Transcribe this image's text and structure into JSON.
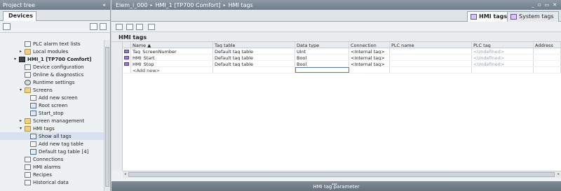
{
  "project_tree": {
    "title": "Project tree",
    "devices_tab": "Devices",
    "items": [
      {
        "label": "PLC alarm text lists",
        "expander": "",
        "icon": "list-icon"
      },
      {
        "label": "Local modules",
        "expander": "▸",
        "icon": "module-folder-icon"
      },
      {
        "label": "HMI_1 [TP700 Comfort]",
        "expander": "▾",
        "icon": "hmi-device-icon"
      },
      {
        "label": "Device configuration",
        "expander": "",
        "icon": "device-config-icon"
      },
      {
        "label": "Online & diagnostics",
        "expander": "",
        "icon": "diagnostics-icon"
      },
      {
        "label": "Runtime settings",
        "expander": "",
        "icon": "runtime-settings-icon"
      },
      {
        "label": "Screens",
        "expander": "▾",
        "icon": "folder-icon"
      },
      {
        "label": "Add new screen",
        "expander": "",
        "icon": "add-screen-icon"
      },
      {
        "label": "Root screen",
        "expander": "",
        "icon": "screen-icon"
      },
      {
        "label": "Start_stop",
        "expander": "",
        "icon": "screen-icon"
      },
      {
        "label": "Screen management",
        "expander": "▸",
        "icon": "folder-icon"
      },
      {
        "label": "HMI tags",
        "expander": "▾",
        "icon": "folder-icon"
      },
      {
        "label": "Show all tags",
        "expander": "",
        "icon": "tag-table-icon"
      },
      {
        "label": "Add new tag table",
        "expander": "",
        "icon": "add-tag-table-icon"
      },
      {
        "label": "Default tag table [4]",
        "expander": "",
        "icon": "tag-table-icon"
      },
      {
        "label": "Connections",
        "expander": "",
        "icon": "connections-icon"
      },
      {
        "label": "HMI alarms",
        "expander": "",
        "icon": "alarms-icon"
      },
      {
        "label": "Recipes",
        "expander": "",
        "icon": "recipes-icon"
      },
      {
        "label": "Historical data",
        "expander": "",
        "icon": "historical-data-icon"
      }
    ]
  },
  "breadcrumb": {
    "parts": [
      "Elem_i_000",
      "HMI_1 [TP700 Comfort]",
      "HMI tags"
    ],
    "separator": "▸"
  },
  "tabs": {
    "hmi_tags": "HMI tags",
    "system_tags": "System tags"
  },
  "editor": {
    "title": "HMI tags",
    "columns": [
      "Name ▲",
      "Tag table",
      "Data type",
      "Connection",
      "PLC name",
      "PLC tag",
      "Address"
    ],
    "rows": [
      {
        "name": "Tag_ScreenNumber",
        "tag_table": "Default tag table",
        "data_type": "UInt",
        "connection": "<Internal tag>",
        "plc_name": "",
        "plc_tag": "<Undefined>",
        "address": ""
      },
      {
        "name": "HMI_Start",
        "tag_table": "Default tag table",
        "data_type": "Bool",
        "connection": "<Internal tag>",
        "plc_name": "",
        "plc_tag": "<Undefined>",
        "address": ""
      },
      {
        "name": "HMI_Stop",
        "tag_table": "Default tag table",
        "data_type": "Bool",
        "connection": "<Internal tag>",
        "plc_name": "",
        "plc_tag": "<Undefined>",
        "address": ""
      }
    ],
    "add_new": "<Add new>"
  },
  "bottom_panel": {
    "label": "HMI tag parameter"
  }
}
